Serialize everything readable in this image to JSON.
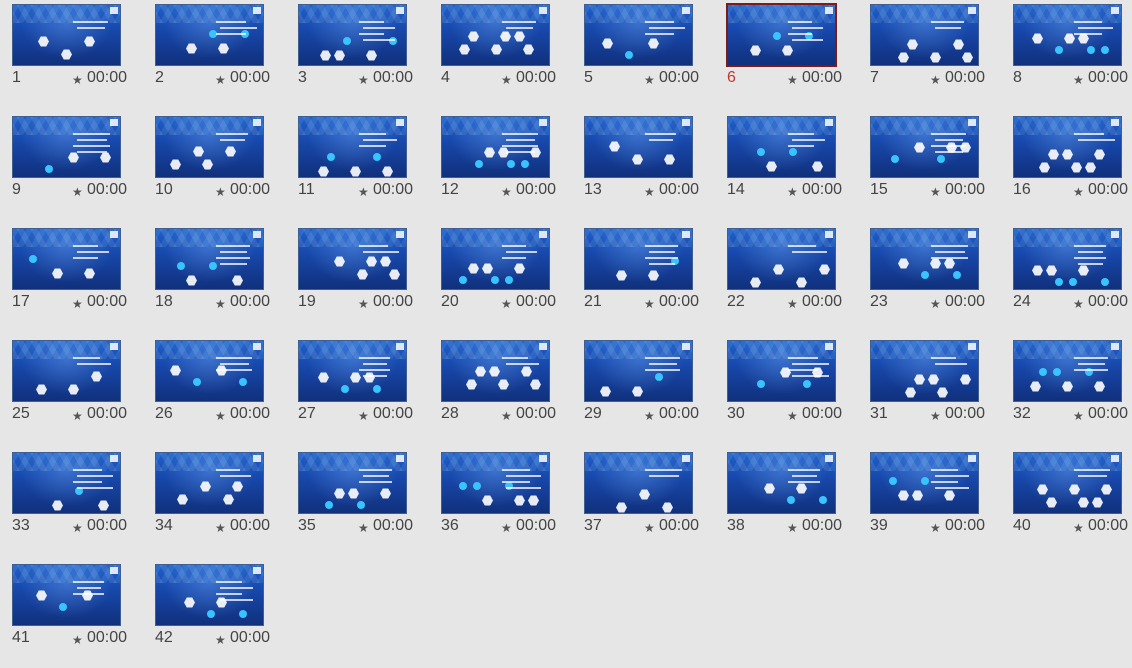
{
  "slide_sorter": {
    "selected_slide": "6",
    "slides": [
      {
        "number": "1",
        "time": "00:00"
      },
      {
        "number": "2",
        "time": "00:00"
      },
      {
        "number": "3",
        "time": "00:00"
      },
      {
        "number": "4",
        "time": "00:00"
      },
      {
        "number": "5",
        "time": "00:00"
      },
      {
        "number": "6",
        "time": "00:00"
      },
      {
        "number": "7",
        "time": "00:00"
      },
      {
        "number": "8",
        "time": "00:00"
      },
      {
        "number": "9",
        "time": "00:00"
      },
      {
        "number": "10",
        "time": "00:00"
      },
      {
        "number": "11",
        "time": "00:00"
      },
      {
        "number": "12",
        "time": "00:00"
      },
      {
        "number": "13",
        "time": "00:00"
      },
      {
        "number": "14",
        "time": "00:00"
      },
      {
        "number": "15",
        "time": "00:00"
      },
      {
        "number": "16",
        "time": "00:00"
      },
      {
        "number": "17",
        "time": "00:00"
      },
      {
        "number": "18",
        "time": "00:00"
      },
      {
        "number": "19",
        "time": "00:00"
      },
      {
        "number": "20",
        "time": "00:00"
      },
      {
        "number": "21",
        "time": "00:00"
      },
      {
        "number": "22",
        "time": "00:00"
      },
      {
        "number": "23",
        "time": "00:00"
      },
      {
        "number": "24",
        "time": "00:00"
      },
      {
        "number": "25",
        "time": "00:00"
      },
      {
        "number": "26",
        "time": "00:00"
      },
      {
        "number": "27",
        "time": "00:00"
      },
      {
        "number": "28",
        "time": "00:00"
      },
      {
        "number": "29",
        "time": "00:00"
      },
      {
        "number": "30",
        "time": "00:00"
      },
      {
        "number": "31",
        "time": "00:00"
      },
      {
        "number": "32",
        "time": "00:00"
      },
      {
        "number": "33",
        "time": "00:00"
      },
      {
        "number": "34",
        "time": "00:00"
      },
      {
        "number": "35",
        "time": "00:00"
      },
      {
        "number": "36",
        "time": "00:00"
      },
      {
        "number": "37",
        "time": "00:00"
      },
      {
        "number": "38",
        "time": "00:00"
      },
      {
        "number": "39",
        "time": "00:00"
      },
      {
        "number": "40",
        "time": "00:00"
      },
      {
        "number": "41",
        "time": "00:00"
      },
      {
        "number": "42",
        "time": "00:00"
      }
    ],
    "timing_icon": "star-icon",
    "timing_icon_glyph": "★",
    "colors": {
      "background": "#e6e6e6",
      "slide_theme": "#1746a8",
      "selected_border": "#7a1c1c",
      "selected_number": "#c0392b"
    }
  }
}
